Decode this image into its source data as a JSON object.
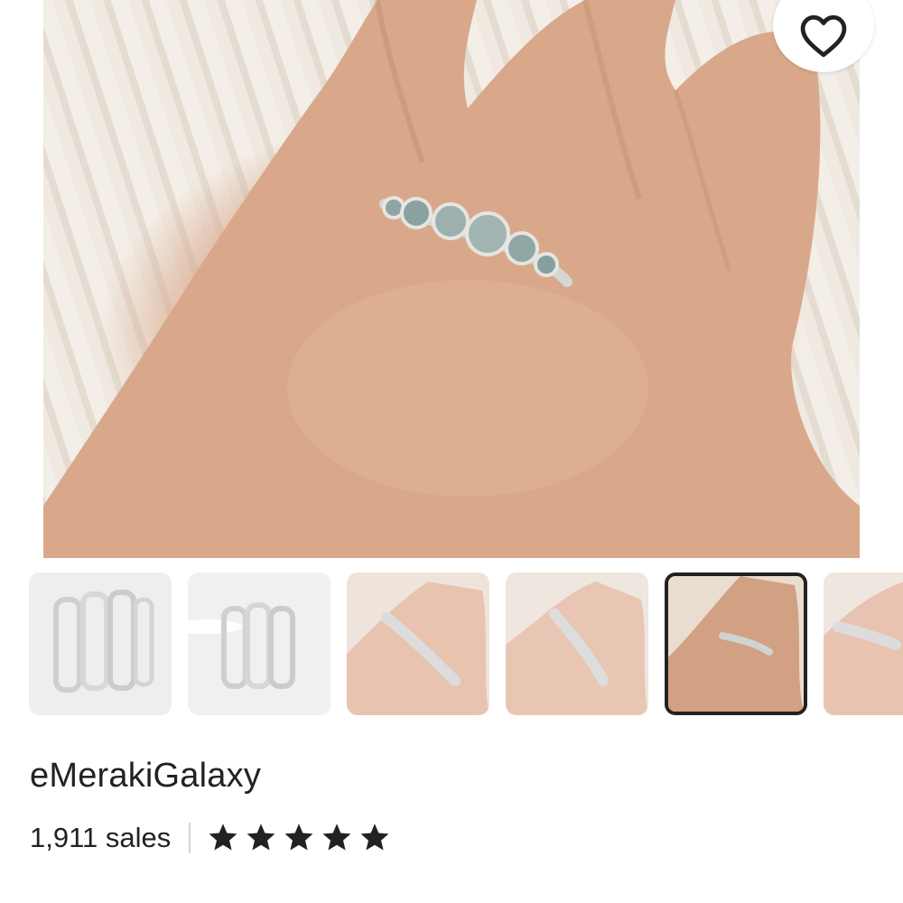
{
  "listing": {
    "main_image": {
      "icon": "ring-on-hand-photo"
    },
    "favorite": {
      "icon": "heart-outline-icon"
    },
    "thumbnails": [
      {
        "icon": "stacked-rings-photo",
        "selected": false
      },
      {
        "icon": "ring-stack-photo",
        "selected": false
      },
      {
        "icon": "hand-two-rings-photo",
        "selected": false
      },
      {
        "icon": "hand-two-rings-photo-2",
        "selected": false
      },
      {
        "icon": "ring-on-finger-photo",
        "selected": true
      },
      {
        "icon": "hand-rings-photo-partial",
        "selected": false
      }
    ]
  },
  "shop": {
    "name": "eMerakiGalaxy",
    "sales": "1,911 sales",
    "rating": 5,
    "rating_max": 5
  },
  "colors": {
    "text": "#222222",
    "selected_border": "#222222",
    "divider": "#d5d5d5"
  }
}
